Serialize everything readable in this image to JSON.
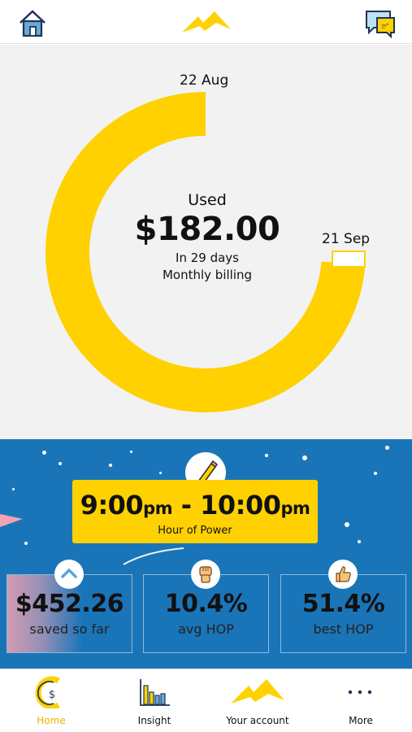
{
  "header": {
    "home_icon": "home-icon",
    "logo_icon": "brand-logo-icon",
    "chat_icon": "chat-icon"
  },
  "usage": {
    "start_date": "22 Aug",
    "end_date": "21 Sep",
    "used_label": "Used",
    "amount": "$182.00",
    "days_text": "In 29 days",
    "billing_text": "Monthly billing",
    "progress_fraction": 0.97,
    "ring_color": "#ffd100"
  },
  "hop": {
    "time_start": "9:00",
    "time_start_suffix": "pm",
    "separator": "-",
    "time_end": "10:00",
    "time_end_suffix": "pm",
    "caption": "Hour of Power",
    "background_color": "#1a75b8",
    "box_color": "#ffd100",
    "stats": [
      {
        "value": "$452.26",
        "label": "saved so far",
        "icon": "chevron-up-icon"
      },
      {
        "value": "10.4%",
        "label": "avg HOP",
        "icon": "fist-icon"
      },
      {
        "value": "51.4%",
        "label": "best HOP",
        "icon": "thumbs-up-icon"
      }
    ]
  },
  "nav": {
    "items": [
      {
        "label": "Home",
        "icon": "home-dollar-icon",
        "active": true
      },
      {
        "label": "Insight",
        "icon": "insight-chart-icon",
        "active": false
      },
      {
        "label": "Your account",
        "icon": "brand-logo-icon",
        "active": false
      },
      {
        "label": "More",
        "icon": "more-icon",
        "active": false
      }
    ],
    "active_color": "#e8b400"
  }
}
